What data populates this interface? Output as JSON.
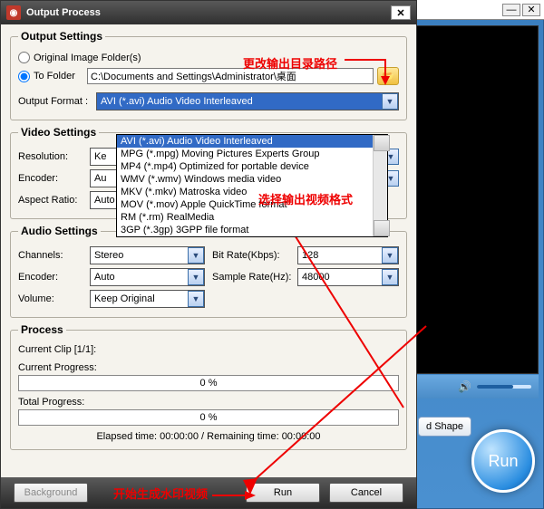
{
  "bg": {
    "min": "—",
    "cls": "✕",
    "shape_btn": "d Shape",
    "run": "Run"
  },
  "dialog": {
    "title": "Output Process",
    "close": "✕",
    "output_settings": {
      "legend": "Output Settings",
      "original_label": "Original Image Folder(s)",
      "tofolder_label": "To Folder",
      "folder_path": "C:\\Documents and Settings\\Administrator\\桌面",
      "format_label": "Output Format :",
      "format_value": "AVI   (*.avi) Audio Video Interleaved",
      "format_options": [
        "AVI   (*.avi) Audio Video Interleaved",
        "MPG (*.mpg) Moving Pictures Experts Group",
        "MP4  (*.mp4) Optimized for portable device",
        "WMV (*.wmv) Windows media video",
        "MKV  (*.mkv) Matroska video",
        "MOV  (*.mov) Apple QuickTime format",
        "RM    (*.rm) RealMedia",
        "3GP  (*.3gp) 3GPP file format"
      ]
    },
    "video_settings": {
      "legend": "Video Settings",
      "resolution_label": "Resolution:",
      "resolution_value": "Ke",
      "encoder_label": "Encoder:",
      "encoder_value": "Au",
      "aspect_label": "Aspect Ratio:",
      "aspect_value": "Auto"
    },
    "audio_settings": {
      "legend": "Audio Settings",
      "channels_label": "Channels:",
      "channels_value": "Stereo",
      "encoder_label": "Encoder:",
      "encoder_value": "Auto",
      "volume_label": "Volume:",
      "volume_value": "Keep Original",
      "bitrate_label": "Bit Rate(Kbps):",
      "bitrate_value": "128",
      "samplerate_label": "Sample Rate(Hz):",
      "samplerate_value": "48000"
    },
    "process": {
      "legend": "Process",
      "current_clip": "Current Clip [1/1]:",
      "current_progress_label": "Current Progress:",
      "current_progress_value": "0 %",
      "total_progress_label": "Total Progress:",
      "total_progress_value": "0 %",
      "time_text": "Elapsed time: 00:00:00    /    Remaining time: 00:00:00"
    },
    "buttons": {
      "background": "Background",
      "run": "Run",
      "cancel": "Cancel"
    }
  },
  "annotations": {
    "change_path": "更改输出目录路径",
    "select_format": "选择输出视频格式",
    "start_watermark": "开始生成水印视频"
  }
}
